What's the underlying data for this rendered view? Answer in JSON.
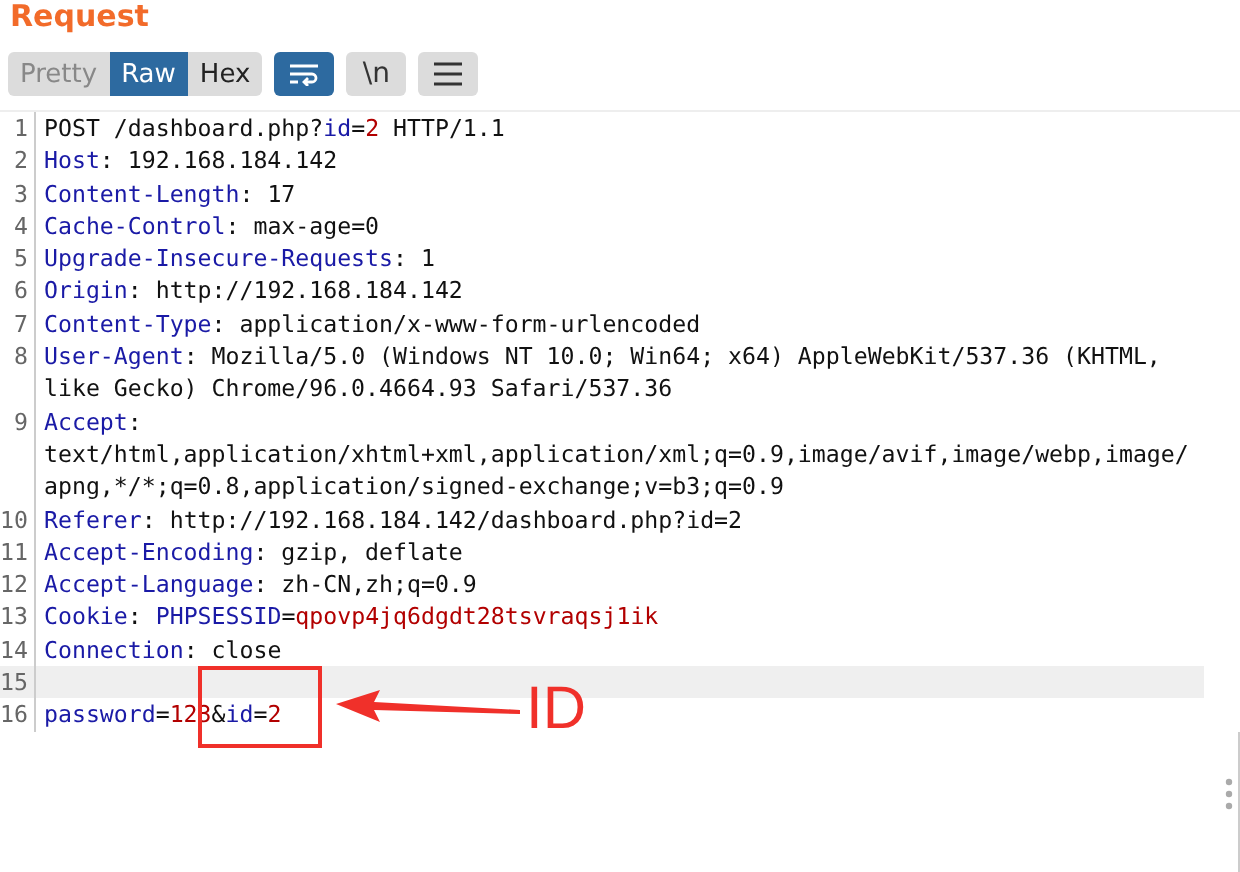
{
  "panel": {
    "title": "Request"
  },
  "view_tabs": [
    {
      "label": "Pretty",
      "selected": false
    },
    {
      "label": "Raw",
      "selected": true
    },
    {
      "label": "Hex",
      "selected": false
    }
  ],
  "toolbar": [
    {
      "kind": "wrap",
      "selected": true
    },
    {
      "kind": "text",
      "label": "\\n",
      "selected": false
    },
    {
      "kind": "menu",
      "selected": false
    }
  ],
  "lines": [
    {
      "number": "1",
      "highlighted": false,
      "rows": [
        [
          {
            "kind": "plain",
            "text": "POST /dashboard.php?"
          },
          {
            "kind": "key",
            "text": "id"
          },
          {
            "kind": "plain",
            "text": "="
          },
          {
            "kind": "value",
            "text": "2"
          },
          {
            "kind": "plain",
            "text": " HTTP/1.1"
          }
        ]
      ]
    },
    {
      "number": "2",
      "highlighted": false,
      "rows": [
        [
          {
            "kind": "key",
            "text": "Host"
          },
          {
            "kind": "plain",
            "text": ": 192.168.184.142"
          }
        ]
      ]
    },
    {
      "number": "3",
      "highlighted": false,
      "rows": [
        [
          {
            "kind": "key",
            "text": "Content-Length"
          },
          {
            "kind": "plain",
            "text": ": 17"
          }
        ]
      ]
    },
    {
      "number": "4",
      "highlighted": false,
      "rows": [
        [
          {
            "kind": "key",
            "text": "Cache-Control"
          },
          {
            "kind": "plain",
            "text": ": max-age=0"
          }
        ]
      ]
    },
    {
      "number": "5",
      "highlighted": false,
      "rows": [
        [
          {
            "kind": "key",
            "text": "Upgrade-Insecure-Requests"
          },
          {
            "kind": "plain",
            "text": ": 1"
          }
        ]
      ]
    },
    {
      "number": "6",
      "highlighted": false,
      "rows": [
        [
          {
            "kind": "key",
            "text": "Origin"
          },
          {
            "kind": "plain",
            "text": ": http://192.168.184.142"
          }
        ]
      ]
    },
    {
      "number": "7",
      "highlighted": false,
      "rows": [
        [
          {
            "kind": "key",
            "text": "Content-Type"
          },
          {
            "kind": "plain",
            "text": ": application/x-www-form-urlencoded"
          }
        ]
      ]
    },
    {
      "number": "8",
      "highlighted": false,
      "rows": [
        [
          {
            "kind": "key",
            "text": "User-Agent"
          },
          {
            "kind": "plain",
            "text": ": Mozilla/5.0 (Windows NT 10.0; Win64; x64) AppleWebKit/537.36 (KHTML,"
          }
        ],
        [
          {
            "kind": "plain",
            "text": "like Gecko) Chrome/96.0.4664.93 Safari/537.36"
          }
        ]
      ]
    },
    {
      "number": "9",
      "highlighted": false,
      "rows": [
        [
          {
            "kind": "key",
            "text": "Accept"
          },
          {
            "kind": "plain",
            "text": ":"
          }
        ],
        [
          {
            "kind": "plain",
            "text": "text/html,application/xhtml+xml,application/xml;q=0.9,image/avif,image/webp,image/"
          }
        ],
        [
          {
            "kind": "plain",
            "text": "apng,*/*;q=0.8,application/signed-exchange;v=b3;q=0.9"
          }
        ]
      ]
    },
    {
      "number": "10",
      "highlighted": false,
      "rows": [
        [
          {
            "kind": "key",
            "text": "Referer"
          },
          {
            "kind": "plain",
            "text": ": http://192.168.184.142/dashboard.php?id=2"
          }
        ]
      ]
    },
    {
      "number": "11",
      "highlighted": false,
      "rows": [
        [
          {
            "kind": "key",
            "text": "Accept-Encoding"
          },
          {
            "kind": "plain",
            "text": ": gzip, deflate"
          }
        ]
      ]
    },
    {
      "number": "12",
      "highlighted": false,
      "rows": [
        [
          {
            "kind": "key",
            "text": "Accept-Language"
          },
          {
            "kind": "plain",
            "text": ": zh-CN,zh;q=0.9"
          }
        ]
      ]
    },
    {
      "number": "13",
      "highlighted": false,
      "rows": [
        [
          {
            "kind": "key",
            "text": "Cookie"
          },
          {
            "kind": "plain",
            "text": ": "
          },
          {
            "kind": "key",
            "text": "PHPSESSID"
          },
          {
            "kind": "plain",
            "text": "="
          },
          {
            "kind": "value",
            "text": "qpovp4jq6dgdt28tsvraqsj1ik"
          }
        ]
      ]
    },
    {
      "number": "14",
      "highlighted": false,
      "rows": [
        [
          {
            "kind": "key",
            "text": "Connection"
          },
          {
            "kind": "plain",
            "text": ": close"
          }
        ]
      ]
    },
    {
      "number": "15",
      "highlighted": true,
      "rows": [
        []
      ]
    },
    {
      "number": "16",
      "highlighted": false,
      "rows": [
        [
          {
            "kind": "key",
            "text": "password"
          },
          {
            "kind": "plain",
            "text": "="
          },
          {
            "kind": "value",
            "text": "123"
          },
          {
            "kind": "plain",
            "text": "&"
          },
          {
            "kind": "key",
            "text": "id"
          },
          {
            "kind": "plain",
            "text": "="
          },
          {
            "kind": "value",
            "text": "2"
          }
        ]
      ]
    }
  ],
  "annotation": {
    "label": "ID"
  }
}
